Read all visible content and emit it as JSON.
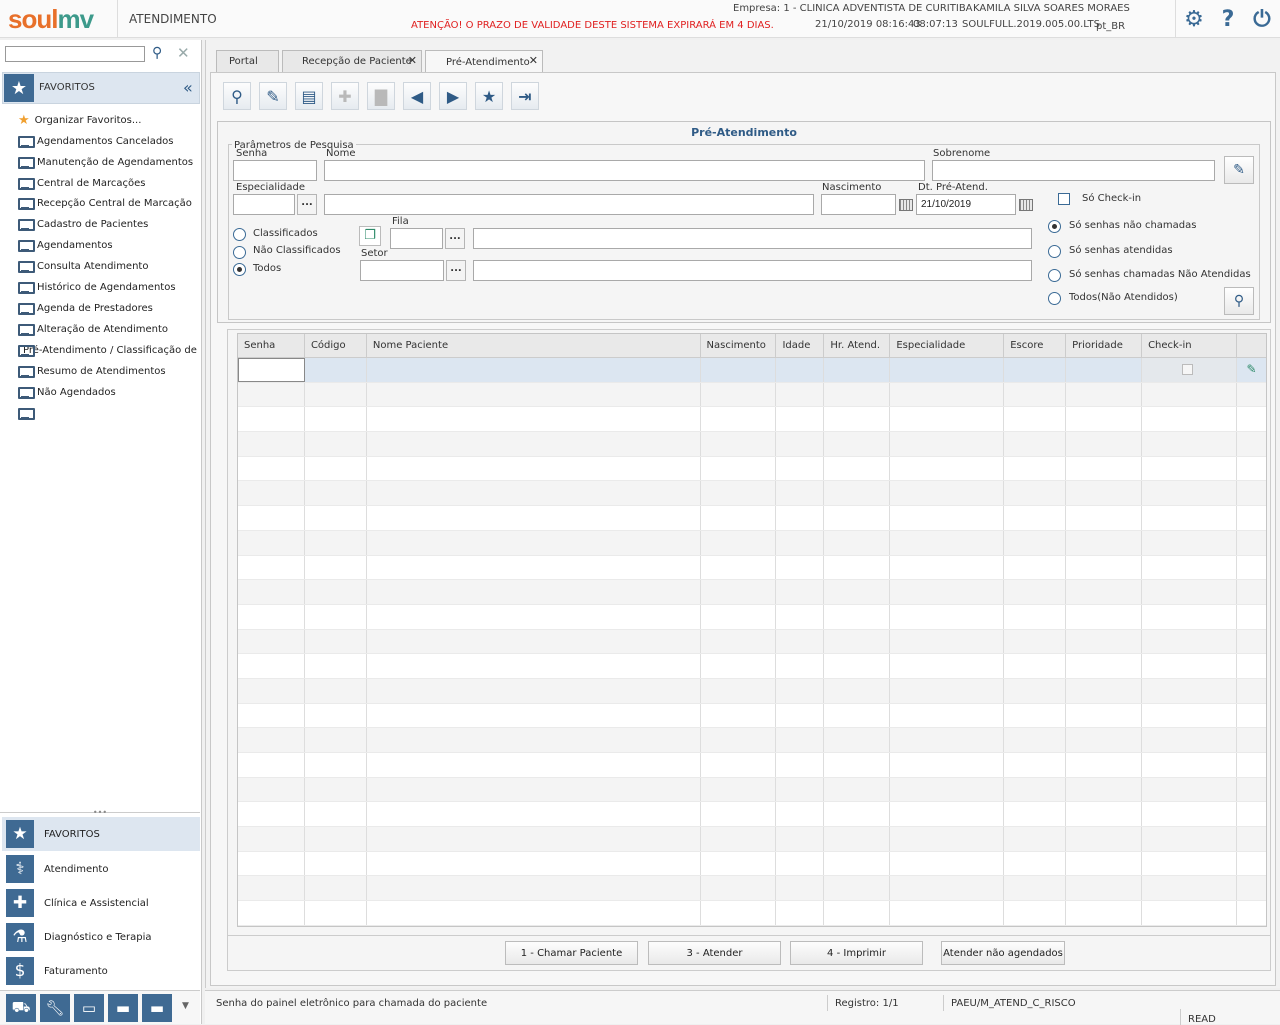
{
  "header": {
    "logo_part1": "soul",
    "logo_part2": "mv",
    "module": "ATENDIMENTO",
    "empresa": "Empresa: 1 - CLINICA ADVENTISTA DE CURITIBA",
    "user": "KAMILA SILVA SOARES MORAES",
    "warning": "ATENÇÃO! O PRAZO DE VALIDADE DESTE SISTEMA EXPIRARÁ EM 4 DIAS.",
    "datetime": "21/10/2019 08:16:43",
    "time": "08:07:13",
    "version": "SOULFULL.2019.005.00.LTS",
    "locale": "pt_BR",
    "icons": [
      "gear-icon",
      "help-icon",
      "power-icon"
    ],
    "warning_color": "#e02020"
  },
  "sidebar": {
    "search_placeholder": "",
    "favorites_title": "FAVORITOS",
    "items": [
      {
        "label": "Organizar Favoritos...",
        "icon": "star-icon"
      },
      {
        "label": "Agendamentos Cancelados",
        "icon": "monitor-icon"
      },
      {
        "label": "Manutenção de Agendamentos",
        "icon": "monitor-icon"
      },
      {
        "label": "Central de Marcações",
        "icon": "monitor-icon"
      },
      {
        "label": "Recepção Central de Marcação",
        "icon": "monitor-icon"
      },
      {
        "label": "Cadastro de Pacientes",
        "icon": "monitor-icon"
      },
      {
        "label": "Agendamentos",
        "icon": "monitor-icon"
      },
      {
        "label": "Consulta Atendimento",
        "icon": "monitor-icon"
      },
      {
        "label": "Histórico de Agendamentos",
        "icon": "monitor-icon"
      },
      {
        "label": "Agenda de Prestadores",
        "icon": "monitor-icon"
      },
      {
        "label": "Alteração de Atendimento",
        "icon": "monitor-icon"
      },
      {
        "label": "Pré-Atendimento / Classificação de I",
        "icon": "monitor-icon"
      },
      {
        "label": "Resumo de Atendimentos",
        "icon": "monitor-icon"
      },
      {
        "label": "Não Agendados",
        "icon": "monitor-icon"
      },
      {
        "label": "",
        "icon": "monitor-icon"
      }
    ],
    "modules": [
      {
        "label": "FAVORITOS",
        "icon": "star-icon"
      },
      {
        "label": "Atendimento",
        "icon": "stethoscope-icon"
      },
      {
        "label": "Clínica e Assistencial",
        "icon": "medkit-icon"
      },
      {
        "label": "Diagnóstico e Terapia",
        "icon": "microscope-icon"
      },
      {
        "label": "Faturamento",
        "icon": "dollar-icon"
      }
    ],
    "bottom_icons": [
      "truck-icon",
      "wrench-icon",
      "monitor-icon",
      "folder-icon",
      "folder-open-icon"
    ]
  },
  "tabs": [
    {
      "label": "Portal",
      "closable": false
    },
    {
      "label": "Recepção de Paciente",
      "closable": true
    },
    {
      "label": "Pré-Atendimento",
      "closable": true,
      "active": true
    }
  ],
  "toolbar": {
    "buttons": [
      {
        "name": "search",
        "icon": "search-icon",
        "enabled": true
      },
      {
        "name": "clear",
        "icon": "broom-icon",
        "enabled": true
      },
      {
        "name": "save",
        "icon": "save-icon",
        "enabled": true
      },
      {
        "name": "add",
        "icon": "plus-icon",
        "enabled": false
      },
      {
        "name": "delete",
        "icon": "trash-icon",
        "enabled": false
      },
      {
        "name": "previous",
        "icon": "arrow-left-icon",
        "enabled": true
      },
      {
        "name": "next",
        "icon": "arrow-right-icon",
        "enabled": true
      },
      {
        "name": "favorite",
        "icon": "star-icon",
        "enabled": true
      },
      {
        "name": "exit",
        "icon": "exit-icon",
        "enabled": true
      }
    ]
  },
  "form": {
    "title": "Pré-Atendimento",
    "group_title": "Parâmetros de Pesquisa",
    "senha_label": "Senha",
    "senha_value": "",
    "nome_label": "Nome",
    "nome_value": "",
    "sobrenome_label": "Sobrenome",
    "sobrenome_value": "",
    "especialidade_label": "Especialidade",
    "especialidade_code": "",
    "especialidade_desc": "",
    "nascimento_label": "Nascimento",
    "nascimento_value": "",
    "dt_pre_label": "Dt. Pré-Atend.",
    "dt_pre_value": "21/10/2019",
    "checkin_label": "Só Check-in",
    "checkin_checked": false,
    "class_options": [
      {
        "label": "Classificados",
        "selected": false
      },
      {
        "label": "Não Classificados",
        "selected": false
      },
      {
        "label": "Todos",
        "selected": true
      }
    ],
    "fila_label": "Fila",
    "fila_code": "",
    "fila_desc": "",
    "setor_label": "Setor",
    "setor_code": "",
    "setor_desc": "",
    "status_options": [
      {
        "label": "Só senhas não chamadas",
        "selected": true
      },
      {
        "label": "Só senhas atendidas",
        "selected": false
      },
      {
        "label": "Só senhas chamadas Não Atendidas",
        "selected": false
      },
      {
        "label": "Todos(Não Atendidos)",
        "selected": false
      }
    ],
    "dots_label": "..."
  },
  "grid": {
    "columns": [
      "Senha",
      "Código",
      "Nome Paciente",
      "Nascimento",
      "Idade",
      "Hr. Atend.",
      "Especialidade",
      "Escore",
      "Prioridade",
      "Check-in",
      ""
    ],
    "rows": []
  },
  "actions": {
    "chamar": "1 - Chamar Paciente",
    "atender": "3 - Atender",
    "imprimir": "4 - Imprimir",
    "nao_agendados": "Atender não agendados"
  },
  "status": {
    "hint": "Senha do painel eletrônico para chamada do paciente",
    "registro": "Registro: 1/1",
    "form_code": "PAEU/M_ATEND_C_RISCO",
    "mode": "READ"
  }
}
